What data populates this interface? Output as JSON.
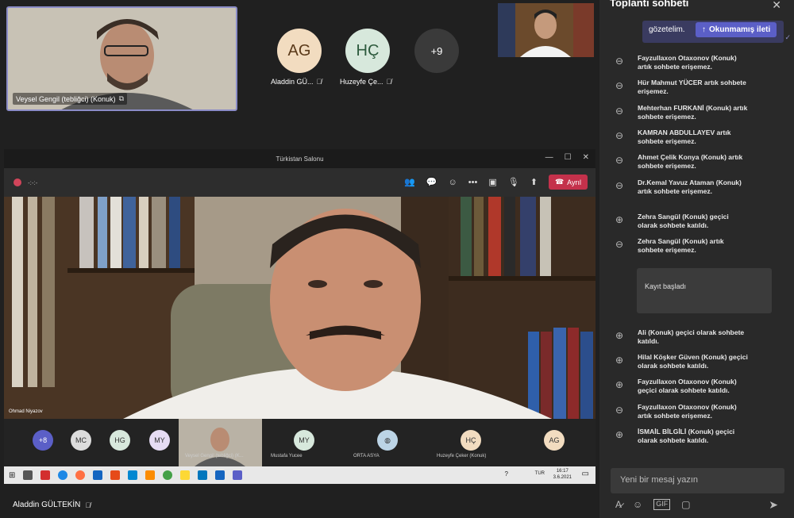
{
  "top_tiles": {
    "speaker_name": "Veysel Gengil (tebliğci) (Konuk)",
    "avatars": [
      {
        "initials": "AG",
        "name": "Aladdin GÜ...",
        "bg": "#f2dcc0"
      },
      {
        "initials": "HÇ",
        "name": "Huzeyfe Çe...",
        "bg": "#d7e8dc"
      }
    ],
    "overflow": "+9"
  },
  "screen": {
    "window_title": "Türkistan Salonu",
    "call_timer": "-:-:-",
    "leave_label": "Ayrıl",
    "main_speaker_label": "Ohmad Niyazov",
    "strip": [
      {
        "initials": "+8",
        "bg": "#5b5fc7",
        "label": ""
      },
      {
        "initials": "MC",
        "bg": "#ddd",
        "label": ""
      },
      {
        "initials": "HG",
        "bg": "#d7e8dc",
        "label": ""
      },
      {
        "initials": "MY",
        "bg": "#e6dcf4",
        "label": ""
      },
      {
        "initials": "",
        "bg": "#999",
        "label": "Veysel Gengil (tebliğci) (K..."
      },
      {
        "initials": "MY",
        "bg": "#d7e8dc",
        "label": "Mustafa Yucee"
      },
      {
        "initials": "",
        "bg": "#bcd4e6",
        "label": "ORTA ASYA"
      },
      {
        "initials": "HÇ",
        "bg": "#f2dcc0",
        "label": "Huzeyfe Çeker (Konuk)"
      },
      {
        "initials": "AG",
        "bg": "#f2dcc0",
        "label": ""
      }
    ],
    "clock_time": "16:17",
    "clock_date": "3.6.2021",
    "keyboard": "TUR"
  },
  "bottom_name": "Aladdin GÜLTEKİN",
  "chat": {
    "title": "Toplantı sohbeti",
    "bubble_text": "gözetelim.",
    "unread_label": "Okunmamış ileti",
    "events": [
      {
        "icon": "leave",
        "text": "Fayzullaxon Otaxonov (Konuk) artık sohbete erişemez."
      },
      {
        "icon": "leave",
        "text": "Hür Mahmut YÜCER artık sohbete erişemez."
      },
      {
        "icon": "leave",
        "text": "Mehterhan FURKANİ (Konuk) artık sohbete erişemez."
      },
      {
        "icon": "leave",
        "text": "KAMRAN ABDULLAYEV artık sohbete erişemez."
      },
      {
        "icon": "leave",
        "text": "Ahmet Çelik Konya (Konuk) artık sohbete erişemez."
      },
      {
        "icon": "leave",
        "text": "Dr.Kemal Yavuz Ataman (Konuk) artık sohbete erişemez."
      },
      {
        "icon": "join",
        "text": "Zehra Sangül (Konuk) geçici olarak sohbete katıldı."
      },
      {
        "icon": "leave",
        "text": "Zehra Sangül (Konuk) artık sohbete erişemez."
      }
    ],
    "record_card": "Kayıt başladı",
    "events_after": [
      {
        "icon": "join",
        "text": "Ali (Konuk) geçici olarak sohbete katıldı."
      },
      {
        "icon": "join",
        "text": "Hilal Köşker Güven (Konuk) geçici olarak sohbete katıldı."
      },
      {
        "icon": "join",
        "text": "Fayzullaxon Otaxonov (Konuk) geçici olarak sohbete katıldı."
      },
      {
        "icon": "leave",
        "text": "Fayzullaxon Otaxonov (Konuk) artık sohbete erişemez."
      },
      {
        "icon": "join",
        "text": "İSMAİL BİLGİLİ (Konuk) geçici olarak sohbete katıldı."
      }
    ],
    "compose_placeholder": "Yeni bir mesaj yazın"
  }
}
